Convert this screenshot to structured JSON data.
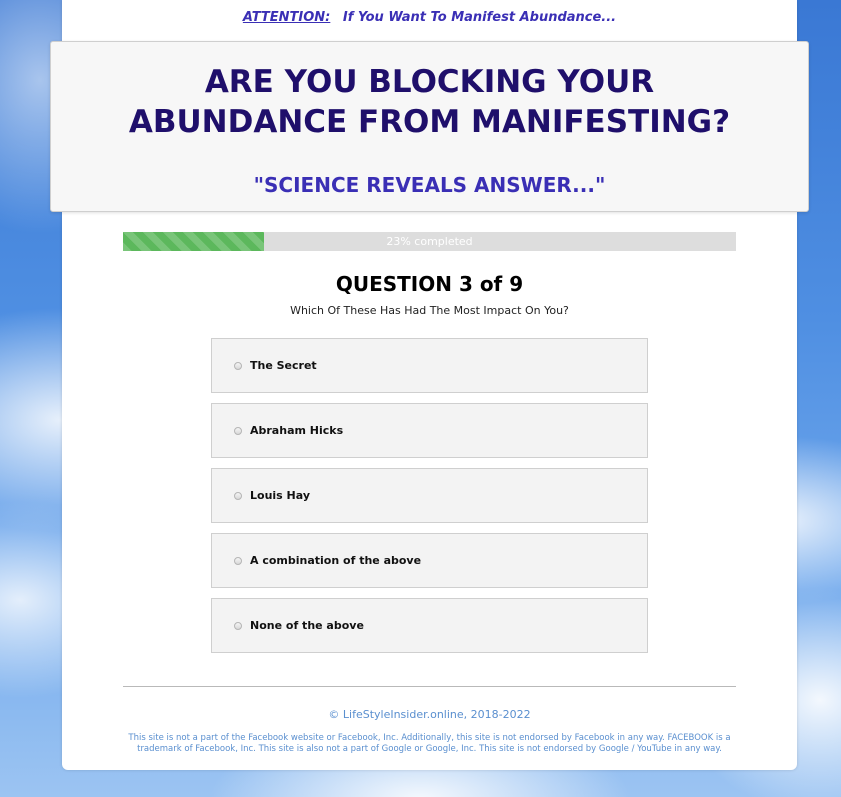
{
  "attention": {
    "label": "ATTENTION:",
    "text": "If You Want To Manifest Abundance..."
  },
  "headline": {
    "title": "ARE YOU BLOCKING YOUR ABUNDANCE FROM MANIFESTING?",
    "subtitle": "\"SCIENCE REVEALS ANSWER...\""
  },
  "progress": {
    "percent": 23,
    "label": "23% completed",
    "fill_color": "#5cb85c"
  },
  "question": {
    "title": "QUESTION 3 of 9",
    "text": "Which Of These Has Had The Most Impact On You?",
    "options": [
      {
        "label": "The Secret"
      },
      {
        "label": "Abraham Hicks"
      },
      {
        "label": "Louis Hay"
      },
      {
        "label": "A combination of the above"
      },
      {
        "label": "None of the above"
      }
    ]
  },
  "footer": {
    "copyright": "© LifeStyleInsider.online, 2018-2022",
    "disclaimer": "This site is not a part of the Facebook website or Facebook, Inc. Additionally, this site is not endorsed by Facebook in any way. FACEBOOK is a trademark of Facebook, Inc. This site is also not a part of Google or Google, Inc. This site is not endorsed by Google / YouTube in any way."
  },
  "colors": {
    "headline": "#1f0f6b",
    "accent": "#3a2fb5",
    "footer_text": "#5a8fcf"
  }
}
